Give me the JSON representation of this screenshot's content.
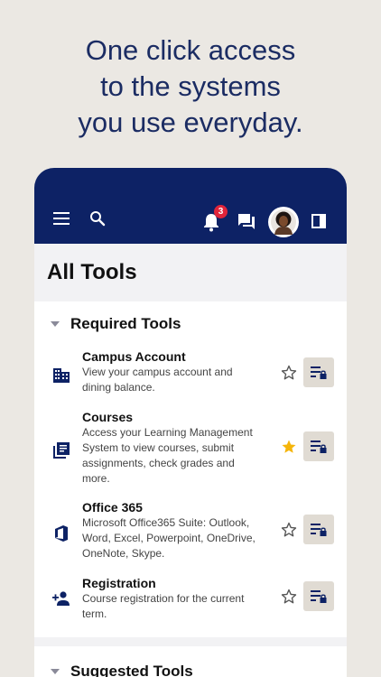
{
  "headline": {
    "line1": "One click access",
    "line2": "to the systems",
    "line3": "you use everyday."
  },
  "topbar": {
    "menu_icon": "hamburger-menu-icon",
    "search_icon": "search-icon",
    "notifications_icon": "bell-icon",
    "notification_count": "3",
    "chat_icon": "chat-icon",
    "avatar": "user-avatar",
    "panel_icon": "side-panel-icon",
    "background_color": "#0d2265",
    "badge_color": "#e0243a"
  },
  "page": {
    "title": "All Tools"
  },
  "sections": [
    {
      "title": "Required Tools",
      "tools": [
        {
          "name": "Campus Account",
          "description": "View your campus account and dining balance.",
          "icon": "building-icon",
          "favorited": false
        },
        {
          "name": "Courses",
          "description": "Access your Learning Management System to view courses, submit assignments, check grades and more.",
          "icon": "library-books-icon",
          "favorited": true
        },
        {
          "name": "Office 365",
          "description": "Microsoft Office365 Suite: Outlook, Word, Excel, Powerpoint, OneDrive, OneNote, Skype.",
          "icon": "office-logo-icon",
          "favorited": false
        },
        {
          "name": "Registration",
          "description": "Course registration for the current term.",
          "icon": "person-add-icon",
          "favorited": false
        }
      ]
    },
    {
      "title": "Suggested Tools",
      "tools": []
    }
  ],
  "colors": {
    "star_active": "#f5b50a",
    "star_inactive": "#555555",
    "open_button_bg": "#e0dbd3",
    "accent": "#0d2265"
  }
}
